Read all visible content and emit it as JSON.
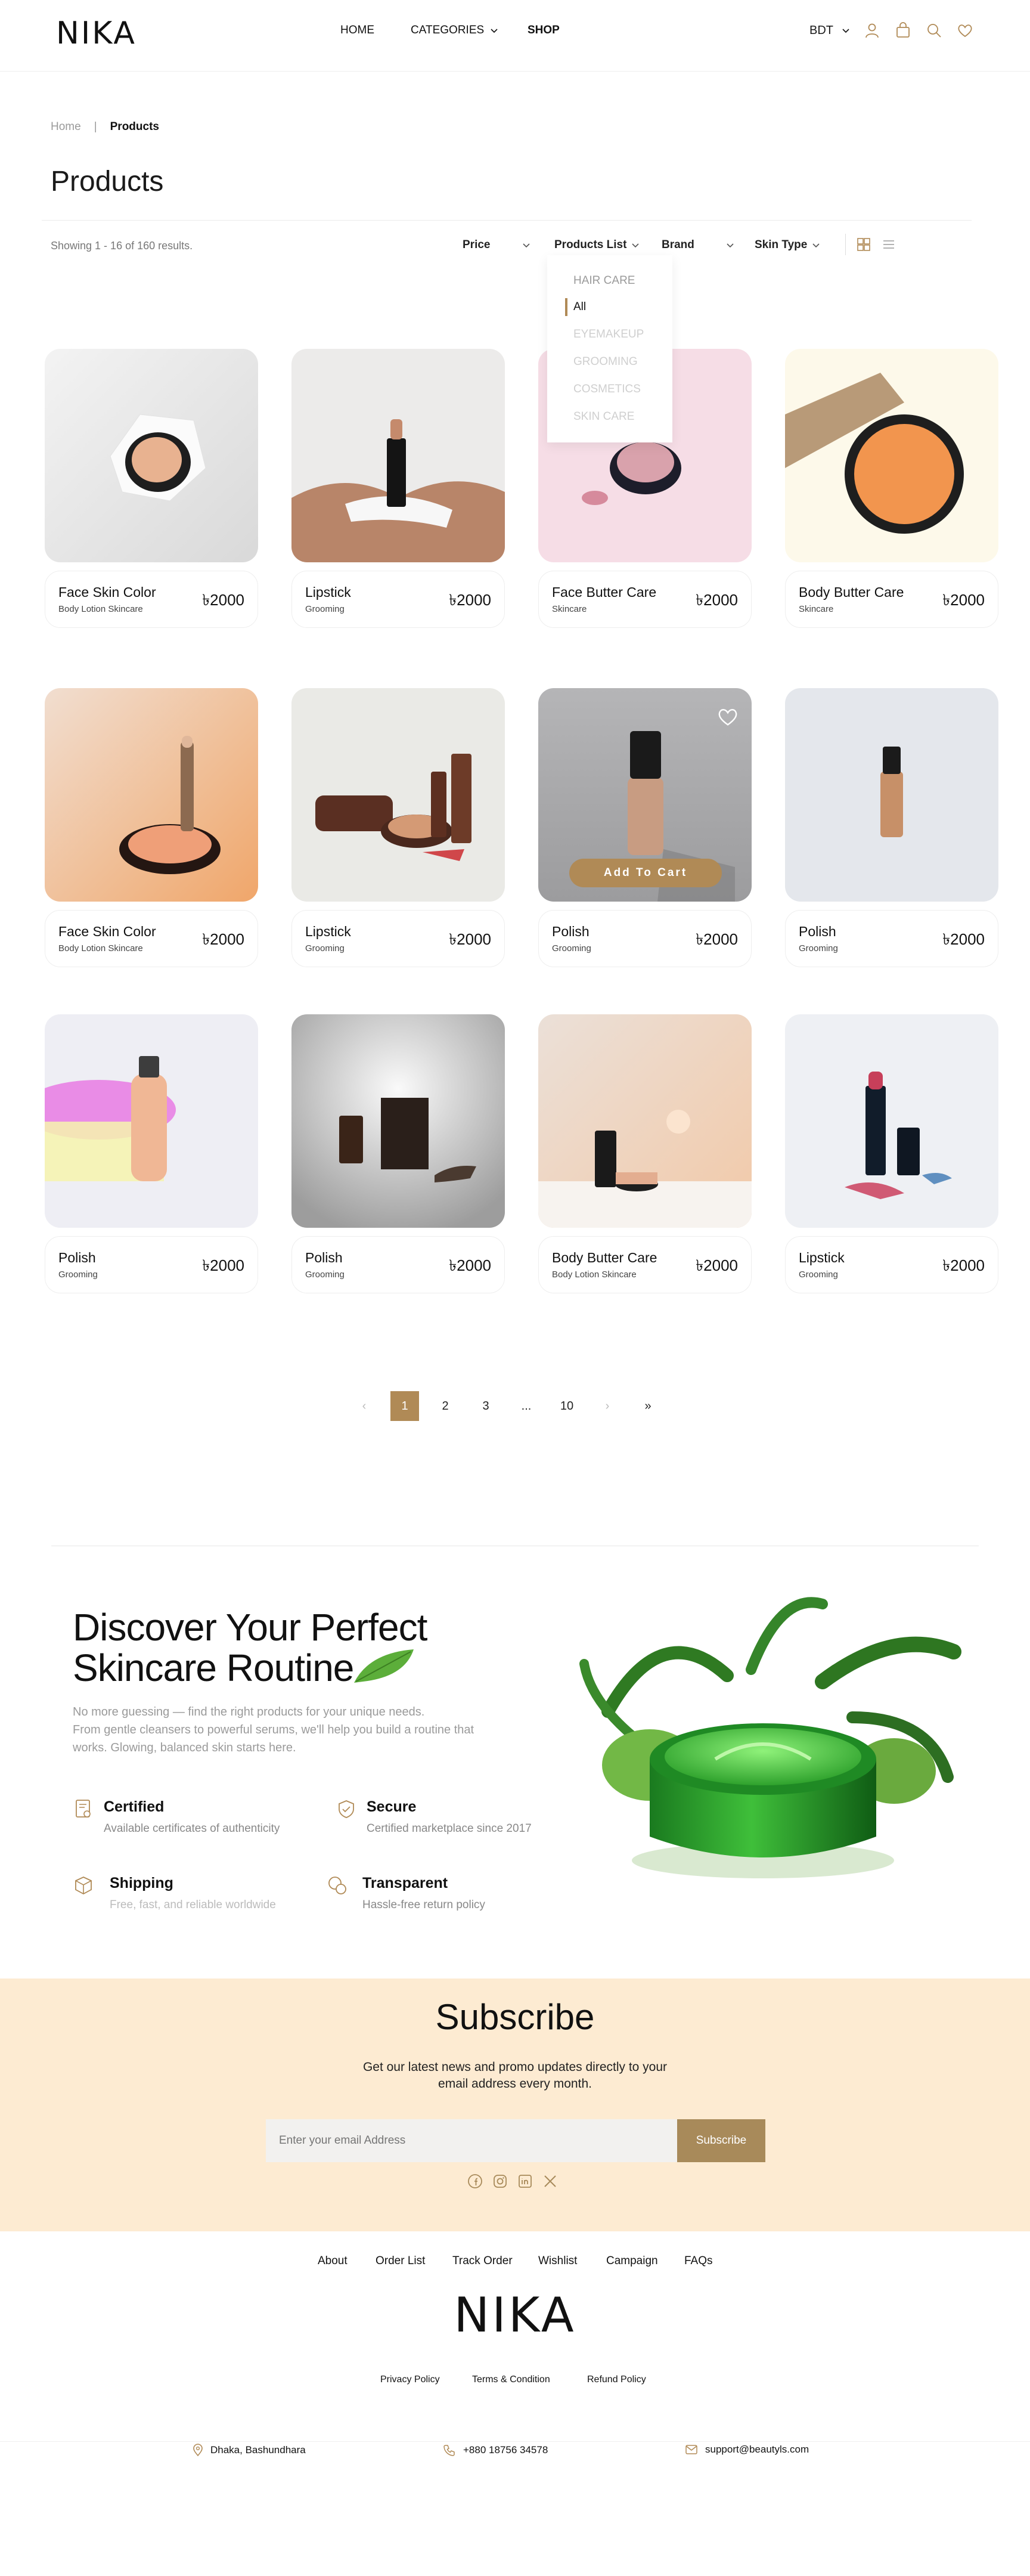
{
  "brand": {
    "name": "NIKA",
    "accent": "#b08a56"
  },
  "nav": {
    "home": "HOME",
    "categories": "CATEGORIES",
    "shop": "SHOP"
  },
  "header": {
    "currency": "BDT",
    "icons": [
      "user-icon",
      "bag-icon",
      "search-icon",
      "heart-icon"
    ]
  },
  "breadcrumb": {
    "home": "Home",
    "sep": "|",
    "current": "Products"
  },
  "page": {
    "title": "Products",
    "results": "Showing 1 - 16 of 160 results."
  },
  "filters": {
    "price": "Price",
    "products_list": "Products List",
    "brand": "Brand",
    "skin_type": "Skin Type"
  },
  "dropdown": {
    "items": [
      "HAIR CARE",
      "All",
      "EYEMAKEUP",
      "GROOMING",
      "COSMETICS",
      "SKIN CARE"
    ],
    "selected": "All"
  },
  "products": [
    {
      "name": "Face Skin Color",
      "category": "Body Lotion Skincare",
      "price": "৳2000"
    },
    {
      "name": "Lipstick",
      "category": "Grooming",
      "price": "৳2000"
    },
    {
      "name": "Face Butter Care",
      "category": "Skincare",
      "price": "৳2000"
    },
    {
      "name": "Body Butter Care",
      "category": "Skincare",
      "price": "৳2000"
    },
    {
      "name": "Face Skin Color",
      "category": "Body Lotion Skincare",
      "price": "৳2000"
    },
    {
      "name": "Lipstick",
      "category": "Grooming",
      "price": "৳2000"
    },
    {
      "name": "Polish",
      "category": "Grooming",
      "price": "৳2000"
    },
    {
      "name": "Polish",
      "category": "Grooming",
      "price": "৳2000"
    },
    {
      "name": "Polish",
      "category": "Grooming",
      "price": "৳2000"
    },
    {
      "name": "Polish",
      "category": "Grooming",
      "price": "৳2000"
    },
    {
      "name": "Body Butter Care",
      "category": "Body Lotion Skincare",
      "price": "৳2000"
    },
    {
      "name": "Lipstick",
      "category": "Grooming",
      "price": "৳2000"
    }
  ],
  "add_to_cart": "Add To Cart",
  "pagination": {
    "prev": "‹",
    "pages": [
      "1",
      "2",
      "3",
      "...",
      "10"
    ],
    "current": "1",
    "next": "›",
    "last": "»"
  },
  "discover": {
    "title_line1": "Discover Your Perfect",
    "title_line2": "Skincare Routine",
    "desc_line1": "No more guessing — find the right products for your unique needs.",
    "desc_line2": "From gentle cleansers to powerful serums, we'll help you build a routine that",
    "desc_line3": "works. Glowing, balanced skin starts here.",
    "features": [
      {
        "title": "Certified",
        "desc": "Available certificates of authenticity",
        "icon": "certificate-icon"
      },
      {
        "title": "Secure",
        "desc": "Certified marketplace since 2017",
        "icon": "shield-icon"
      },
      {
        "title": "Shipping",
        "desc": "Free, fast, and reliable worldwide",
        "icon": "box-icon"
      },
      {
        "title": "Transparent",
        "desc": "Hassle-free return policy",
        "icon": "chat-icon"
      }
    ]
  },
  "subscribe": {
    "title": "Subscribe",
    "desc_line1": "Get our latest news and promo updates directly to your",
    "desc_line2": "email address every month.",
    "placeholder": "Enter your email Address",
    "button": "Subscribe",
    "socials": [
      "facebook-icon",
      "instagram-icon",
      "linkedin-icon",
      "x-icon"
    ]
  },
  "footer": {
    "links": [
      "About",
      "Order List",
      "Track Order",
      "Wishlist",
      "Campaign",
      "FAQs"
    ],
    "logo": "NIKA",
    "policies": [
      "Privacy Policy",
      "Terms & Condition",
      "Refund Policy"
    ],
    "address": "Dhaka, Bashundhara",
    "phone": "+880 18756 34578",
    "email": "support@beautyls.com"
  }
}
